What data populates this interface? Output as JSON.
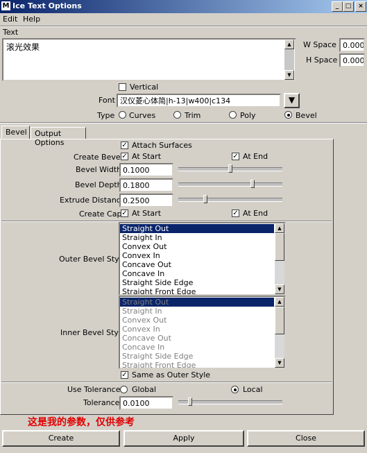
{
  "window": {
    "title": "Ice Text Options",
    "min_glyph": "_",
    "max_glyph": "□",
    "close_glyph": "×"
  },
  "menu": {
    "items": [
      "Edit",
      "Help"
    ]
  },
  "text_section": {
    "label": "Text",
    "value": "滚光效果"
  },
  "spacing": {
    "w_label": "W Space",
    "w_value": "0.000",
    "h_label": "H Space",
    "h_value": "0.000"
  },
  "vertical": {
    "label": "Vertical",
    "checked": false
  },
  "font": {
    "label": "Font",
    "value": "汉仪菱心体简|h-13|w400|c134"
  },
  "type": {
    "label": "Type",
    "options": [
      "Curves",
      "Trim",
      "Poly",
      "Bevel"
    ],
    "selected": "Bevel"
  },
  "tabs": [
    "Bevel",
    "Output Options"
  ],
  "bevel": {
    "attach_surfaces": "Attach Surfaces",
    "create_bevel_label": "Create Bevel",
    "at_start": "At Start",
    "at_end": "At End",
    "bevel_width_label": "Bevel Width",
    "bevel_width": "0.1000",
    "bevel_width_fraction": 0.5,
    "bevel_depth_label": "Bevel Depth",
    "bevel_depth": "0.1800",
    "bevel_depth_fraction": 0.72,
    "extrude_distance_label": "Extrude Distance",
    "extrude_distance": "0.2500",
    "extrude_distance_fraction": 0.25,
    "create_cap_label": "Create Cap",
    "outer_label": "Outer Bevel Style",
    "inner_label": "Inner Bevel Style",
    "styles": [
      "Straight Out",
      "Straight In",
      "Convex Out",
      "Convex In",
      "Concave Out",
      "Concave In",
      "Straight Side Edge",
      "Straight Front Edge"
    ],
    "outer_selected": "Straight Out",
    "inner_selected": "Straight Out",
    "same_as_outer": "Same as Outer Style",
    "use_tolerance_label": "Use Tolerance",
    "tolerance_options": [
      "Global",
      "Local"
    ],
    "tolerance_selected": "Local",
    "tolerance_label": "Tolerance",
    "tolerance": "0.0100",
    "tolerance_fraction": 0.1
  },
  "note": "这是我的参数，仅供参考",
  "buttons": {
    "create": "Create",
    "apply": "Apply",
    "close": "Close"
  },
  "colors": {
    "title_bar": "#0a246a",
    "selection": "#0a246a",
    "note": "#e00000",
    "face": "#d4d0c8"
  }
}
